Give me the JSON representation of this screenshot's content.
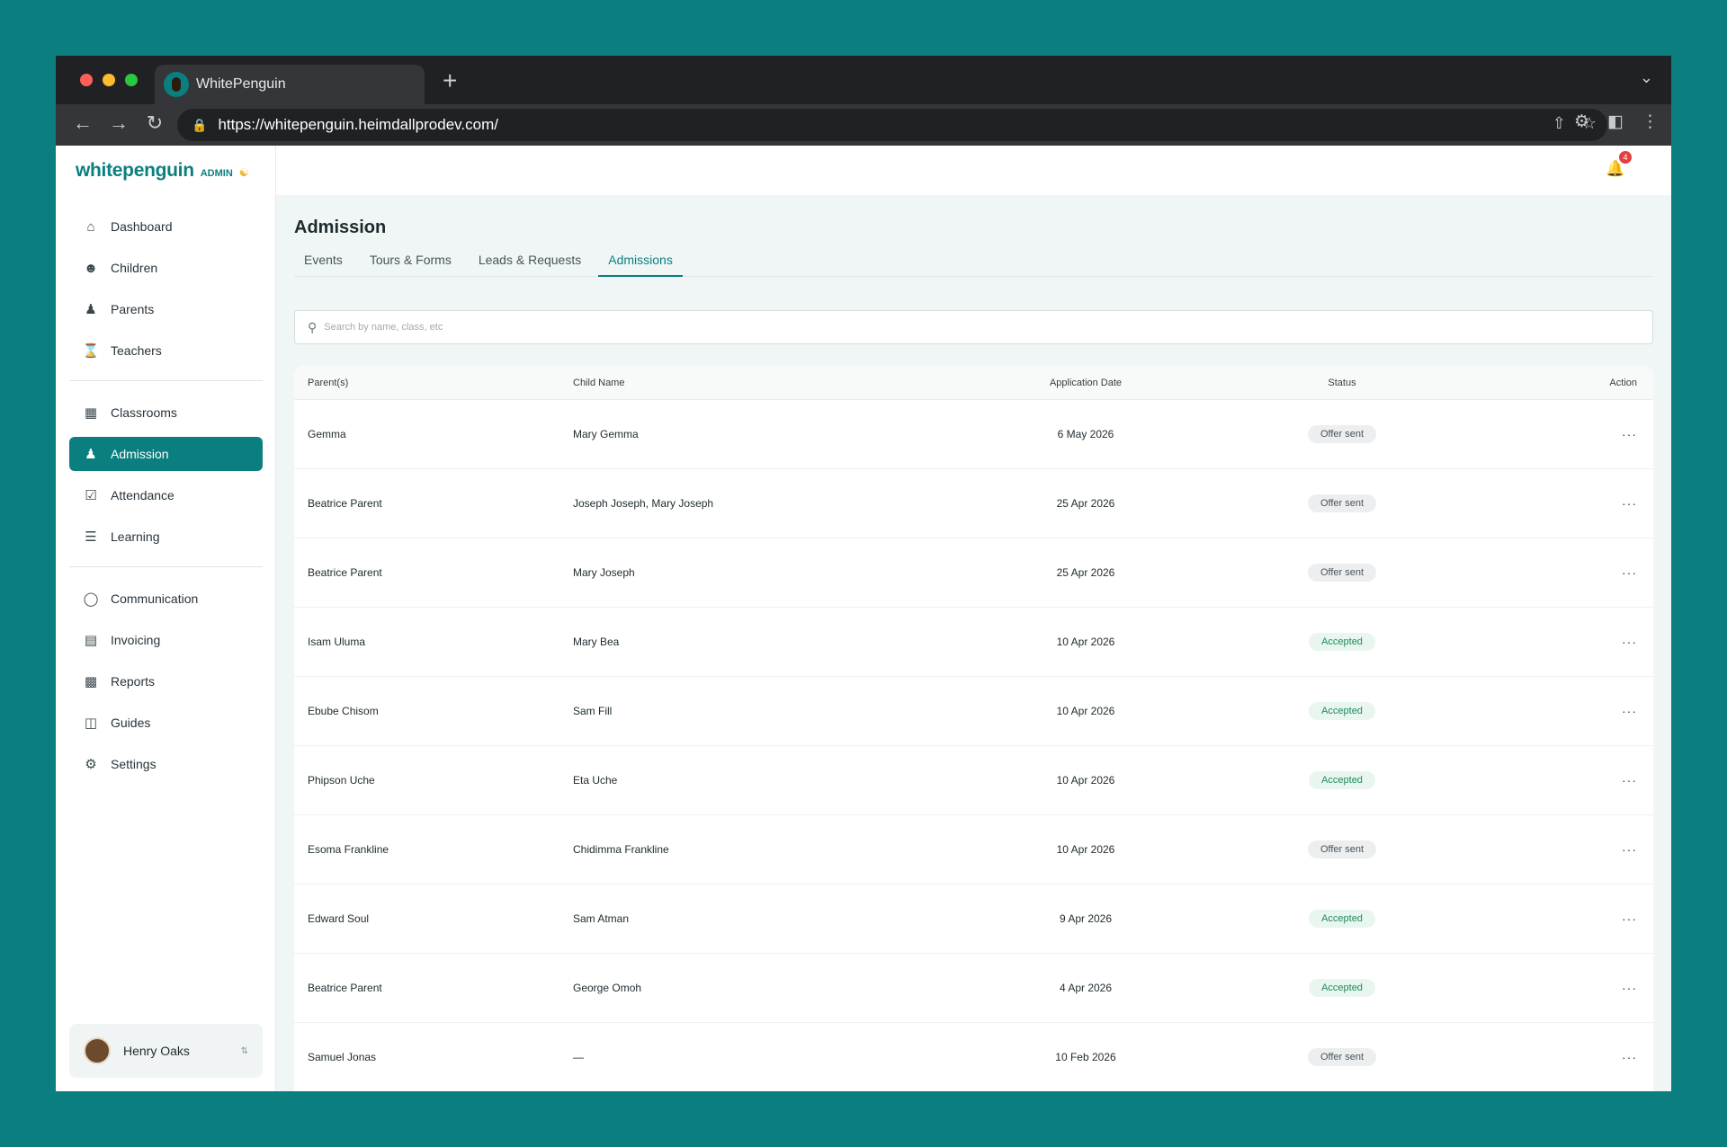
{
  "browser": {
    "tab_title": "WhitePenguin",
    "url": "https://whitepenguin.heimdallprodev.com/"
  },
  "brand": {
    "name": "whitepenguin",
    "role": "ADMIN"
  },
  "sidebar": {
    "items": [
      {
        "label": "Dashboard",
        "icon": "home-icon"
      },
      {
        "label": "Children",
        "icon": "child-icon"
      },
      {
        "label": "Parents",
        "icon": "parents-icon"
      },
      {
        "label": "Teachers",
        "icon": "teacher-icon"
      },
      {
        "label": "Classrooms",
        "icon": "grid-icon"
      },
      {
        "label": "Admission",
        "icon": "user-add-icon"
      },
      {
        "label": "Attendance",
        "icon": "checkbox-icon"
      },
      {
        "label": "Learning",
        "icon": "learning-icon"
      },
      {
        "label": "Communication",
        "icon": "chat-icon"
      },
      {
        "label": "Invoicing",
        "icon": "invoice-icon"
      },
      {
        "label": "Reports",
        "icon": "chart-icon"
      },
      {
        "label": "Guides",
        "icon": "book-icon"
      },
      {
        "label": "Settings",
        "icon": "gear-icon"
      }
    ],
    "active": "Admission"
  },
  "user": {
    "name": "Henry Oaks"
  },
  "notifications": {
    "count": "4"
  },
  "page": {
    "title": "Admission",
    "tabs": [
      "Events",
      "Tours & Forms",
      "Leads & Requests",
      "Admissions"
    ],
    "active_tab": "Admissions",
    "search_placeholder": "Search by name, class, etc"
  },
  "table": {
    "headers": [
      "Parent(s)",
      "Child Name",
      "Application Date",
      "Status",
      "Action"
    ],
    "rows": [
      {
        "parent": "Gemma",
        "child": "Mary Gemma",
        "date": "6 May 2026",
        "status": "Offer sent"
      },
      {
        "parent": "Beatrice Parent",
        "child": "Joseph Joseph, Mary Joseph",
        "date": "25 Apr 2026",
        "status": "Offer sent"
      },
      {
        "parent": "Beatrice Parent",
        "child": "Mary Joseph",
        "date": "25 Apr 2026",
        "status": "Offer sent"
      },
      {
        "parent": "Isam Uluma",
        "child": "Mary Bea",
        "date": "10 Apr 2026",
        "status": "Accepted"
      },
      {
        "parent": "Ebube Chisom",
        "child": "Sam Fill",
        "date": "10 Apr 2026",
        "status": "Accepted"
      },
      {
        "parent": "Phipson Uche",
        "child": "Eta Uche",
        "date": "10 Apr 2026",
        "status": "Accepted"
      },
      {
        "parent": "Esoma Frankline",
        "child": "Chidimma Frankline",
        "date": "10 Apr 2026",
        "status": "Offer sent"
      },
      {
        "parent": "Edward Soul",
        "child": "Sam Atman",
        "date": "9 Apr 2026",
        "status": "Accepted"
      },
      {
        "parent": "Beatrice Parent",
        "child": "George Omoh",
        "date": "4 Apr 2026",
        "status": "Accepted"
      },
      {
        "parent": "Samuel Jonas",
        "child": "—",
        "date": "10 Feb 2026",
        "status": "Offer sent"
      }
    ],
    "action_glyph": "···"
  },
  "colors": {
    "brand": "#0b7f7f",
    "accepted": "#1e8c5a",
    "offer": "#4a5559",
    "badge": "#e53e3e"
  }
}
